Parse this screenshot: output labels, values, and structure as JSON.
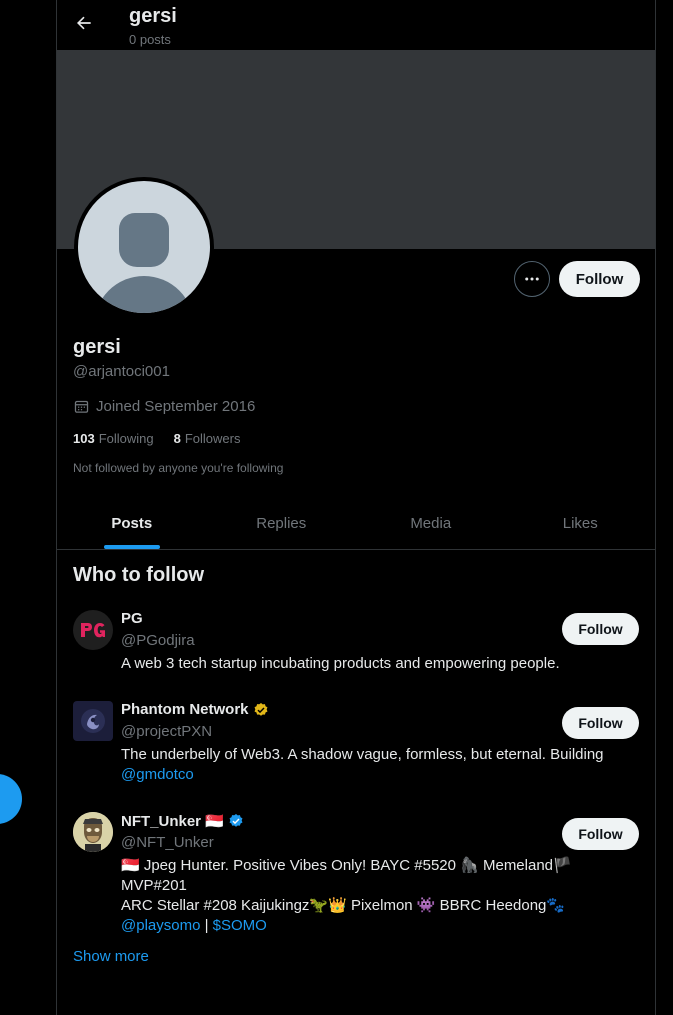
{
  "header": {
    "name": "gersi",
    "post_count": "0 posts"
  },
  "profile": {
    "name": "gersi",
    "handle": "@arjantoci001",
    "joined": "Joined September 2016",
    "following_count": "103",
    "following_label": "Following",
    "followers_count": "8",
    "followers_label": "Followers",
    "not_followed": "Not followed by anyone you're following",
    "follow_label": "Follow",
    "more_label": "···"
  },
  "tabs": [
    {
      "label": "Posts",
      "active": true
    },
    {
      "label": "Replies",
      "active": false
    },
    {
      "label": "Media",
      "active": false
    },
    {
      "label": "Likes",
      "active": false
    }
  ],
  "who_to_follow": {
    "title": "Who to follow",
    "show_more": "Show more",
    "items": [
      {
        "name": "PG",
        "handle": "@PGodjira",
        "bio": "A web 3 tech startup incubating products and empowering people.",
        "follow_label": "Follow",
        "verified": "none"
      },
      {
        "name": "Phantom Network",
        "handle": "@projectPXN",
        "bio": "The underbelly of Web3. A shadow vague, formless, but eternal. Building",
        "bio_link": "@gmdotco",
        "follow_label": "Follow",
        "verified": "gold"
      },
      {
        "name": "NFT_Unker 🇸🇬",
        "handle": "@NFT_Unker",
        "bio_line1": "🇸🇬 Jpeg Hunter. Positive Vibes Only! BAYC #5520 🦍 Memeland🏴 MVP#201",
        "bio_line2": "ARC Stellar #208 Kaijukingz🦖👑 Pixelmon 👾 BBRC Heedong🐾",
        "bio_link1": "@playsomo",
        "bio_sep": " | ",
        "bio_link2": "$SOMO",
        "follow_label": "Follow",
        "verified": "blue"
      }
    ]
  },
  "colors": {
    "background": "#000000",
    "banner": "#333639",
    "accent": "#1d9bf0",
    "muted": "#71767b",
    "text": "#e7e9ea"
  }
}
